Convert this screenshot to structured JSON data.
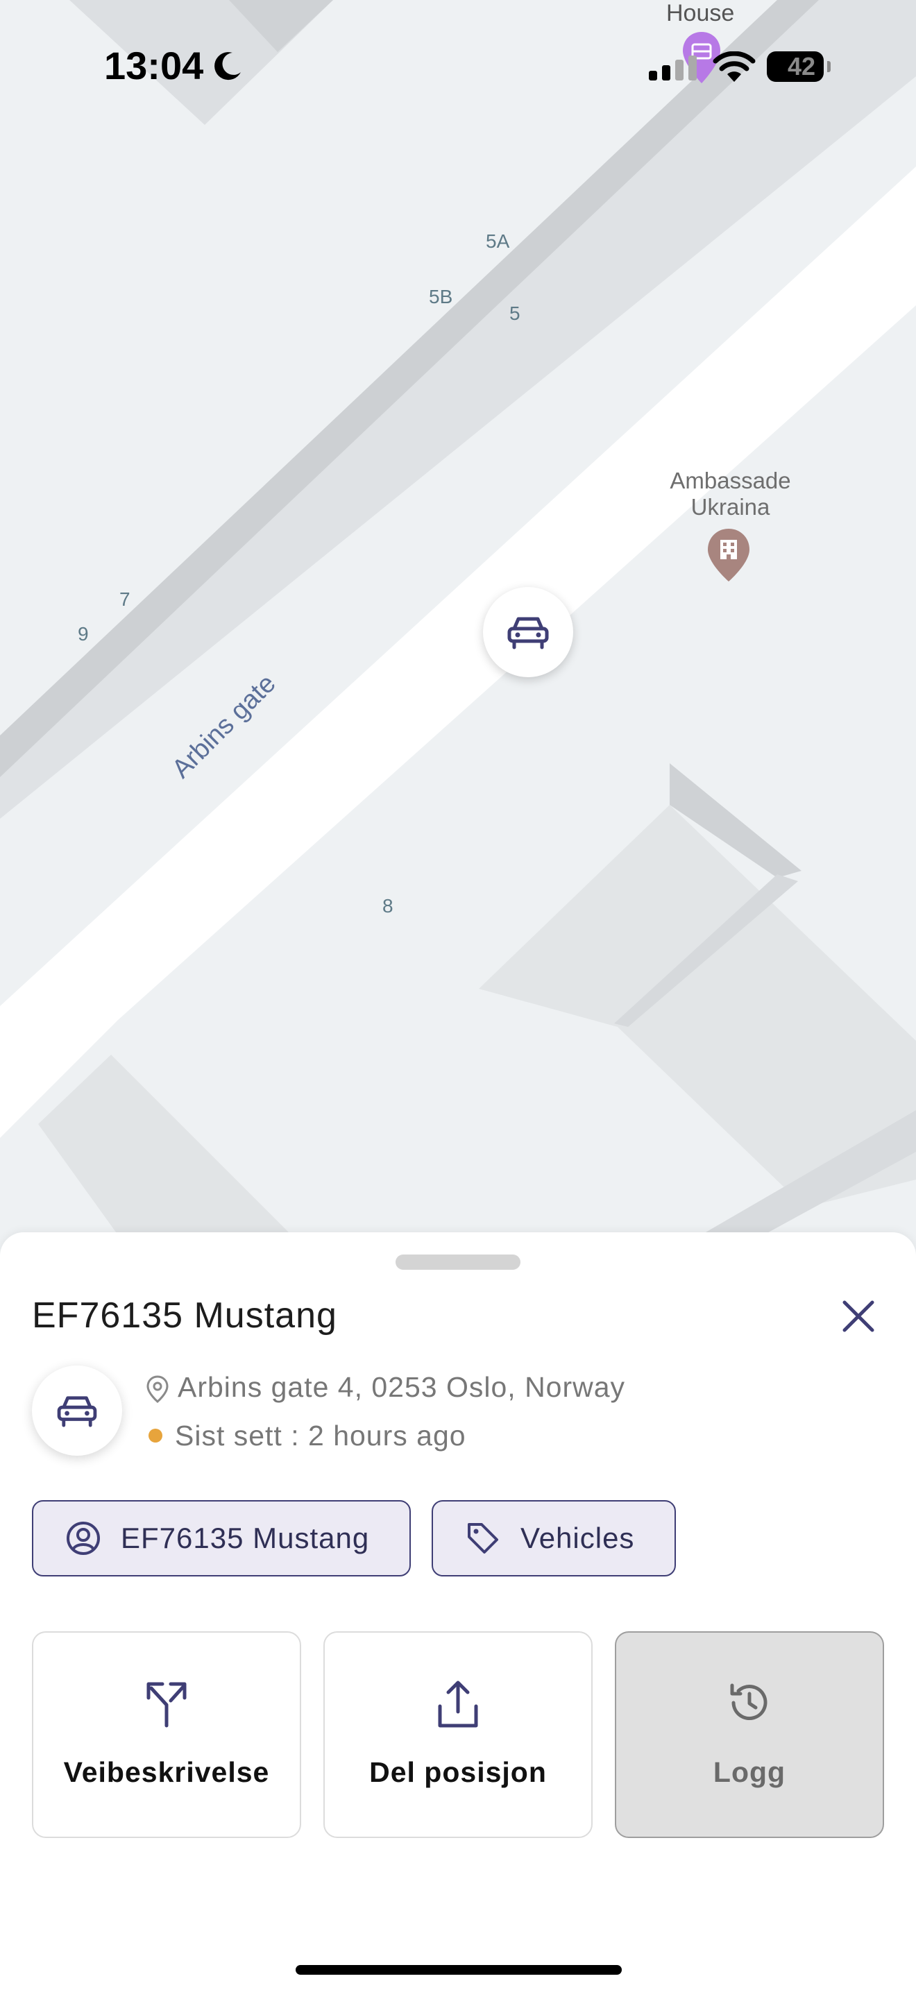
{
  "status_bar": {
    "time": "13:04",
    "battery": "42"
  },
  "map": {
    "house_label": "House",
    "street_name": "Arbins gate",
    "address_numbers": [
      "5A",
      "5B",
      "5",
      "7",
      "9",
      "8"
    ],
    "poi": {
      "name_line1": "Ambassade",
      "name_line2": "Ukraina"
    }
  },
  "sheet": {
    "title": "EF76135 Mustang",
    "address": "Arbins gate 4, 0253 Oslo, Norway",
    "last_seen": "Sist sett : 2 hours ago",
    "last_seen_color": "#e7a43c",
    "chips": [
      {
        "label": "EF76135 Mustang",
        "icon": "user-circle-icon"
      },
      {
        "label": "Vehicles",
        "icon": "tag-icon"
      }
    ],
    "actions": [
      {
        "label": "Veibeskrivelse",
        "icon": "directions-split-icon"
      },
      {
        "label": "Del posisjon",
        "icon": "share-icon"
      },
      {
        "label": "Logg",
        "icon": "history-icon"
      }
    ]
  },
  "colors": {
    "accent": "#3f3e75",
    "chip_bg": "#eceaf4",
    "disabled_tile": "#e0e0e0"
  }
}
